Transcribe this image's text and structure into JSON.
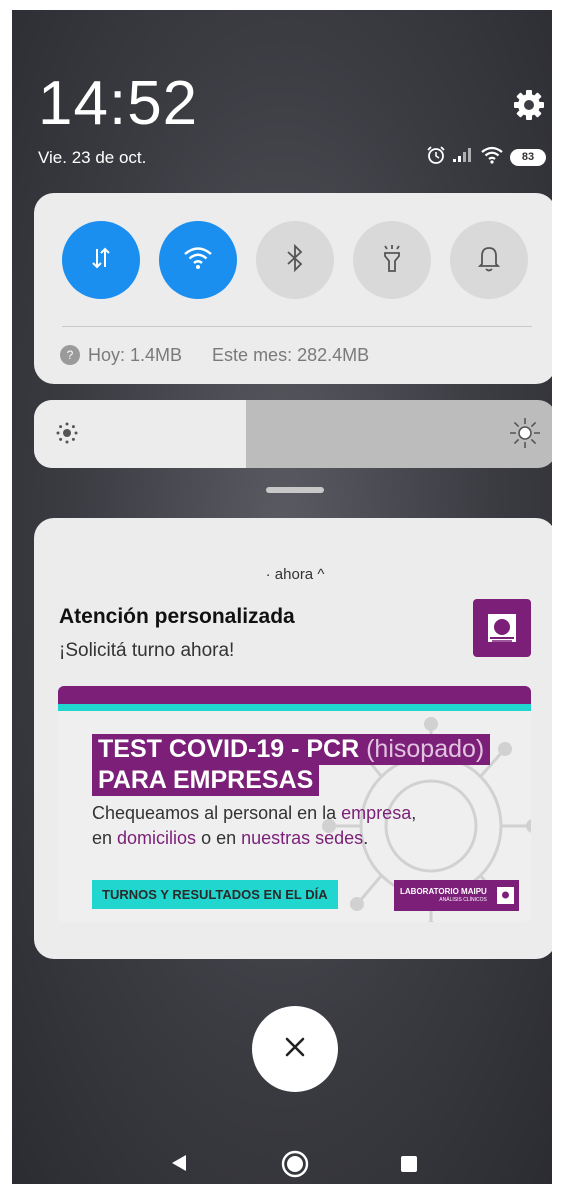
{
  "status": {
    "time": "14:52",
    "date": "Vie. 23 de oct.",
    "battery": "83"
  },
  "quick_settings": {
    "toggles": [
      {
        "name": "mobile-data",
        "state": "on"
      },
      {
        "name": "wifi",
        "state": "on"
      },
      {
        "name": "bluetooth",
        "state": "off"
      },
      {
        "name": "flashlight",
        "state": "off"
      },
      {
        "name": "sound",
        "state": "off"
      }
    ],
    "usage_today": "Hoy: 1.4MB",
    "usage_month": "Este mes: 282.4MB",
    "help_glyph": "?"
  },
  "brightness": {
    "level_percent": 40.6
  },
  "notification": {
    "time": "· ahora ^",
    "title": "Atención personalizada",
    "body": "¡Solicitá turno ahora!",
    "banner": {
      "headline_1": "TEST COVID-19 - PCR",
      "headline_1b": "(hisopado)",
      "headline_2": "PARA EMPRESAS",
      "line1_a": "Chequeamos al personal en la ",
      "line1_b": "empresa",
      "line1_c": ",",
      "line2_a": "en ",
      "line2_b": "domicilios",
      "line2_c": " o en ",
      "line2_d": "nuestras sedes",
      "line2_e": ".",
      "tag": "TURNOS Y RESULTADOS EN EL DÍA",
      "logo": "LABORATORIO MAIPU",
      "logo_sub": "ANÁLISIS CLÍNICOS"
    }
  },
  "colors": {
    "accent_blue": "#1a8ff0",
    "brand_purple": "#7b1f78",
    "brand_cyan": "#21d6cf"
  },
  "icons": {
    "close": "×"
  }
}
